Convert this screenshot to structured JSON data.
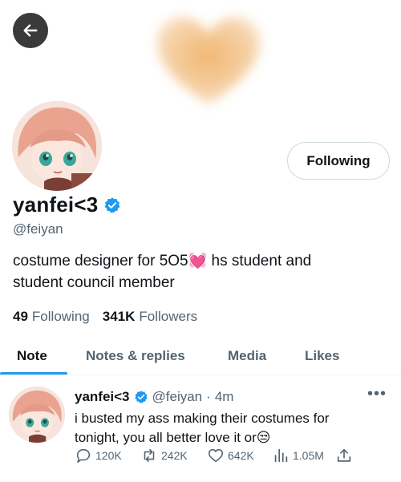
{
  "profile": {
    "display_name": "yanfei<3",
    "handle": "@feiyan",
    "follow_button_label": "Following",
    "bio_line1": "costume designer for 5O5💓 hs student and",
    "bio_line2": "student council member",
    "following_count": "49",
    "following_label": "Following",
    "followers_count": "341K",
    "followers_label": "Followers"
  },
  "tabs": [
    {
      "label": "Note",
      "active": true
    },
    {
      "label": "Notes & replies",
      "active": false
    },
    {
      "label": "Media",
      "active": false
    },
    {
      "label": "Likes",
      "active": false
    }
  ],
  "post": {
    "author_name": "yanfei<3",
    "author_handle": "@feiyan",
    "separator": "·",
    "time": "4m",
    "more_label": "•••",
    "text_line1": "i busted my ass making their costumes for",
    "text_line2": "tonight, you all better love it or😒",
    "replies": "120K",
    "reposts": "242K",
    "likes": "642K",
    "views": "1.05M"
  },
  "icons": {
    "back": "arrow-left-icon",
    "verified": "verified-badge-icon",
    "reply": "reply-icon",
    "repost": "repost-icon",
    "like": "heart-icon",
    "views": "views-icon",
    "share": "share-icon"
  },
  "colors": {
    "accent": "#1d9bf0",
    "text_primary": "#0f1419",
    "text_secondary": "#536471",
    "banner_heart": "#f3c48e"
  }
}
